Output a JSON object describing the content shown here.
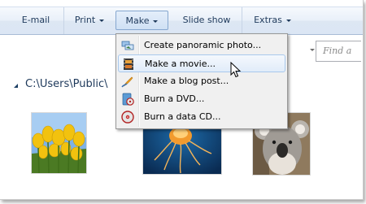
{
  "toolbar": {
    "items": [
      {
        "label": "E-mail"
      },
      {
        "label": "Print"
      },
      {
        "label": "Make"
      },
      {
        "label": "Slide show"
      },
      {
        "label": "Extras"
      }
    ]
  },
  "search": {
    "placeholder": "Find a"
  },
  "path": {
    "text": "C:\\Users\\Public\\"
  },
  "menu": {
    "items": [
      {
        "label": "Create panoramic photo...",
        "icon": "panorama-icon"
      },
      {
        "label": "Make a movie...",
        "icon": "film-strip-icon"
      },
      {
        "label": "Make a blog post...",
        "icon": "blog-pen-icon"
      },
      {
        "label": "Burn a DVD...",
        "icon": "dvd-burn-icon"
      },
      {
        "label": "Burn a data CD...",
        "icon": "cd-burn-icon"
      }
    ]
  },
  "thumbnails": [
    {
      "name": "tulips"
    },
    {
      "name": "jellyfish"
    },
    {
      "name": "koala"
    }
  ],
  "colors": {
    "toolbar_text": "#1e395b",
    "menu_hover_border": "#a8c8ec"
  }
}
